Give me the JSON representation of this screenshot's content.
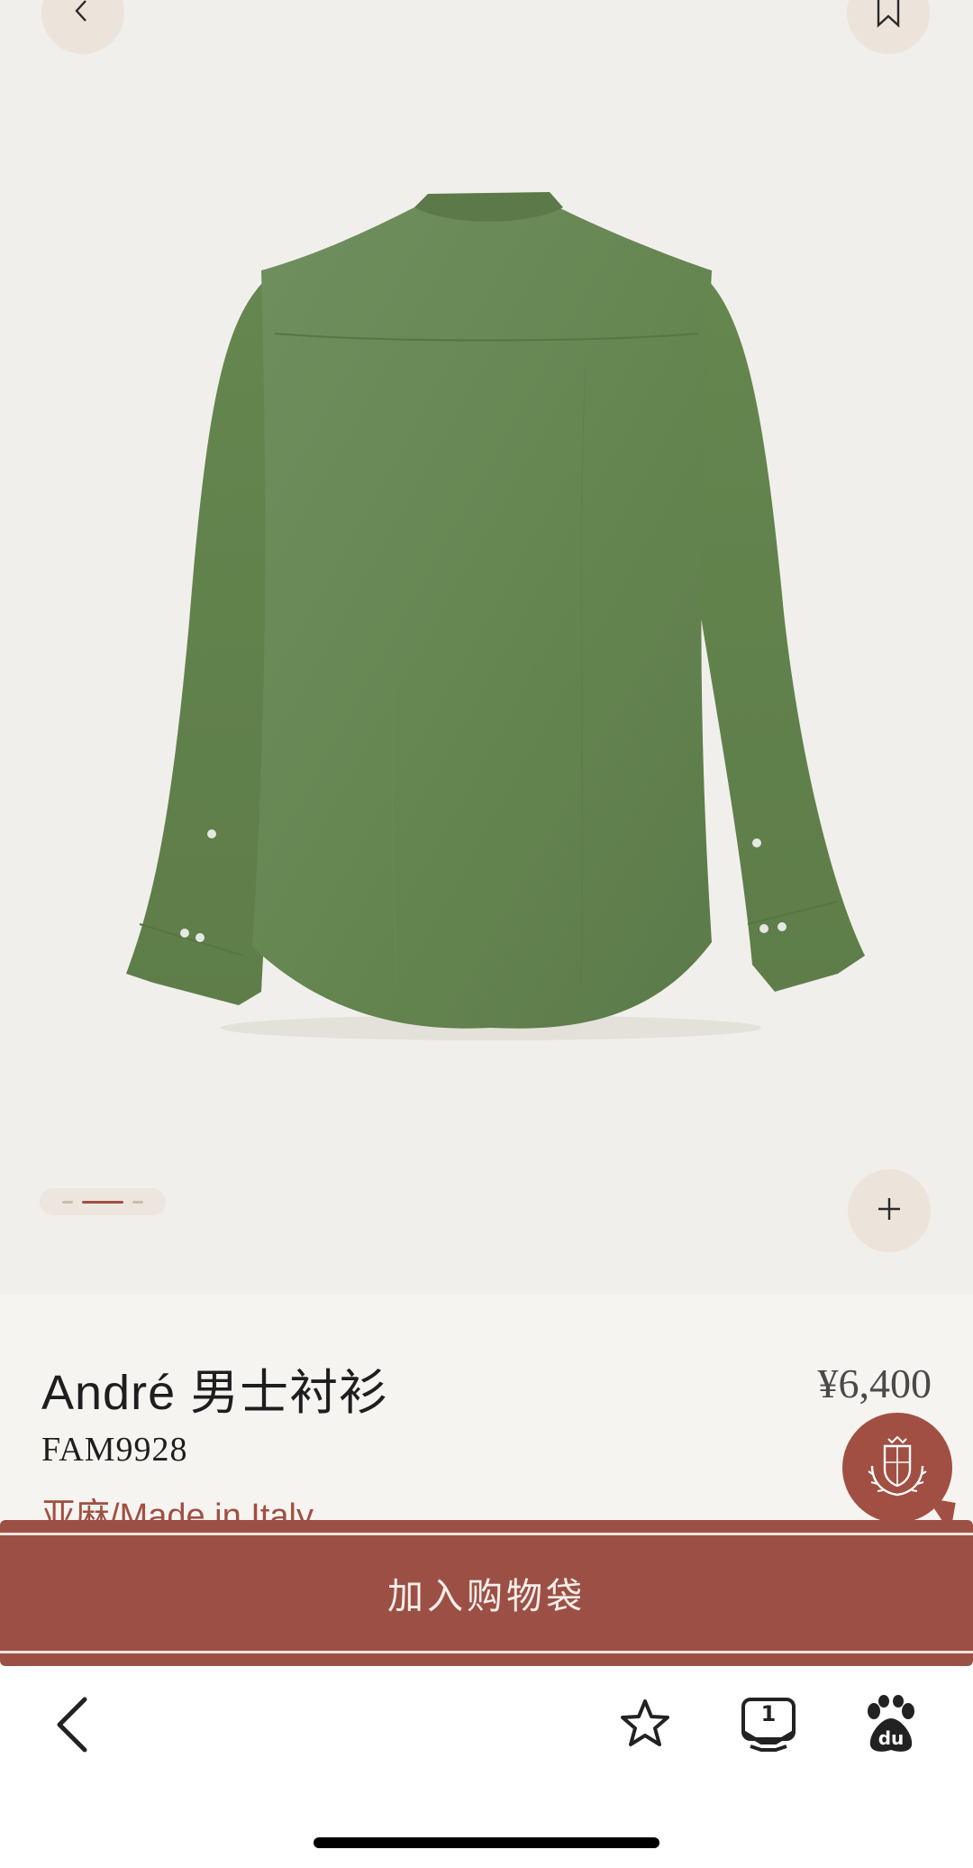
{
  "product": {
    "title": "André 男士衬衫",
    "price": "¥6,400",
    "sku": "FAM9928",
    "material": "亚麻/Made in Italy"
  },
  "gallery": {
    "total_images": 3,
    "active_index": 1
  },
  "actions": {
    "add_to_bag_label": "加入购物袋"
  },
  "browser_toolbar": {
    "tabs_count": "1",
    "baidu_label": "du"
  },
  "icons": {
    "back": "back-chevron-icon",
    "bookmark": "bookmark-icon",
    "zoom": "plus-icon",
    "crest": "crest-logo-icon",
    "favorite": "star-icon",
    "tabs": "tabs-icon",
    "baidu": "baidu-paw-icon"
  },
  "colors": {
    "accent": "#a14f42",
    "hero_background": "#f1efeb",
    "shirt": "#6a8a5a"
  }
}
